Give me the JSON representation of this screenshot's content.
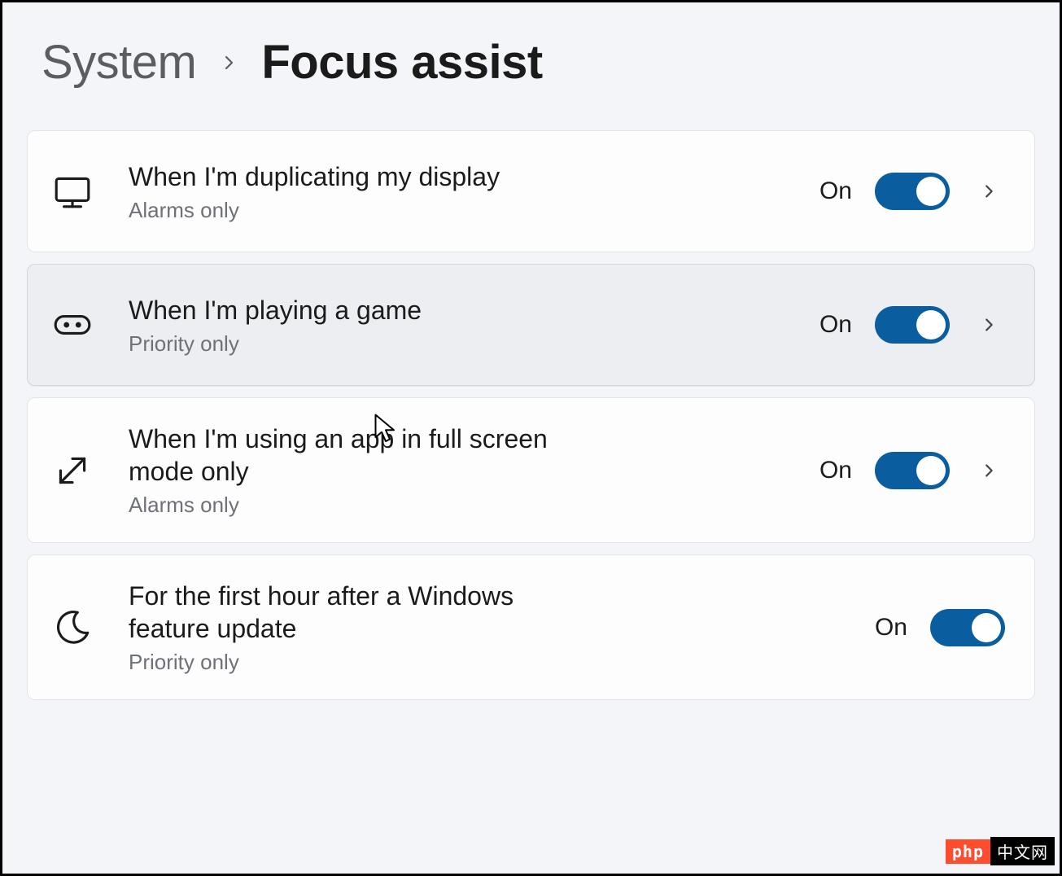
{
  "breadcrumb": {
    "parent": "System",
    "current": "Focus assist"
  },
  "rows": [
    {
      "icon": "monitor-icon",
      "title": "When I'm duplicating my display",
      "subtitle": "Alarms only",
      "state_label": "On",
      "toggle_on": true,
      "expandable": true,
      "hovered": false
    },
    {
      "icon": "gamepad-icon",
      "title": "When I'm playing a game",
      "subtitle": "Priority only",
      "state_label": "On",
      "toggle_on": true,
      "expandable": true,
      "hovered": true
    },
    {
      "icon": "fullscreen-arrow-icon",
      "title": "When I'm using an app in full screen mode only",
      "subtitle": "Alarms only",
      "state_label": "On",
      "toggle_on": true,
      "expandable": true,
      "hovered": false
    },
    {
      "icon": "moon-icon",
      "title": "For the first hour after a Windows feature update",
      "subtitle": "Priority only",
      "state_label": "On",
      "toggle_on": true,
      "expandable": false,
      "hovered": false
    }
  ],
  "colors": {
    "accent": "#0a5ea0",
    "page_bg": "#f3f5f9",
    "card_bg": "#fdfdfe",
    "card_hover_bg": "#eceef2",
    "text": "#1b1b1b",
    "subtext": "#6e7177"
  },
  "watermark": {
    "left": "php",
    "right": "中文网"
  }
}
